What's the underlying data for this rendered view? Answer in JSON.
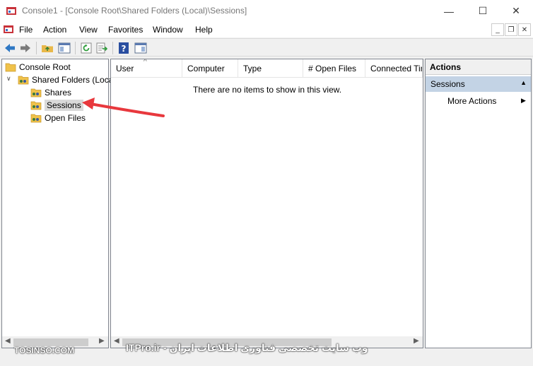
{
  "window": {
    "title": "Console1 - [Console Root\\Shared Folders (Local)\\Sessions]",
    "minimize_glyph": "—",
    "maximize_glyph": "☐",
    "close_glyph": "✕"
  },
  "menubar": {
    "items": [
      "File",
      "Action",
      "View",
      "Favorites",
      "Window",
      "Help"
    ],
    "mdi_minimize": "_",
    "mdi_restore": "❐",
    "mdi_close": "✕"
  },
  "toolbar": {
    "buttons": [
      "back-icon",
      "forward-icon",
      "up-folder-icon",
      "show-hide-tree-icon",
      "refresh-icon",
      "export-list-icon",
      "help-icon",
      "show-hide-action-pane-icon"
    ]
  },
  "tree": {
    "root": "Console Root",
    "shared_folders": "Shared Folders (Local)",
    "children": [
      "Shares",
      "Sessions",
      "Open Files"
    ],
    "expand_glyph": "⌄",
    "collapse_glyph": "∨"
  },
  "list": {
    "columns": [
      "User",
      "Computer",
      "Type",
      "# Open Files",
      "Connected Time"
    ],
    "empty_message": "There are no items to show in this view."
  },
  "actions": {
    "title": "Actions",
    "section": "Sessions",
    "items": [
      "More Actions"
    ]
  },
  "watermark": {
    "left": "TOSINSO.COM",
    "right": "وب سایت تخصصی فناوری اطلاعات ایران - ITPro.ir"
  },
  "colors": {
    "selected_section": "#c3d3e5",
    "annotation_arrow": "#e8383d"
  }
}
